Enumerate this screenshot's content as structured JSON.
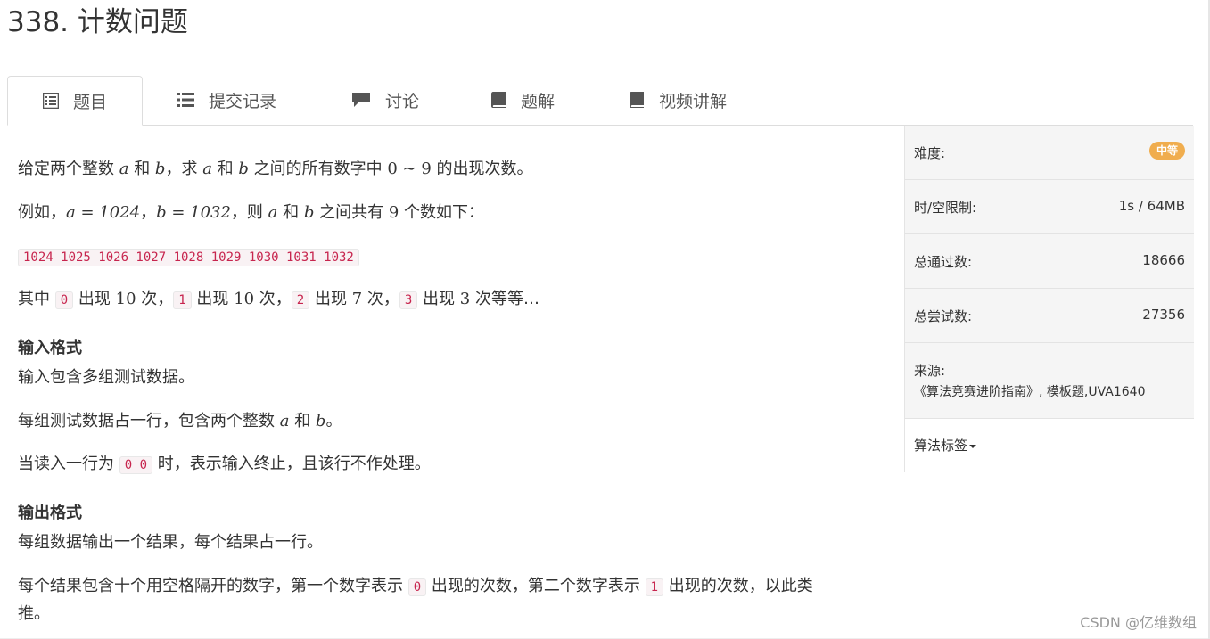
{
  "title": "338. 计数问题",
  "tabs": [
    {
      "label": "题目",
      "icon": "list-alt-icon",
      "active": true
    },
    {
      "label": "提交记录",
      "icon": "list-icon",
      "active": false
    },
    {
      "label": "讨论",
      "icon": "comment-icon",
      "active": false
    },
    {
      "label": "题解",
      "icon": "book-icon",
      "active": false
    },
    {
      "label": "视频讲解",
      "icon": "book-icon",
      "active": false
    }
  ],
  "sidebar": {
    "difficulty_label": "难度:",
    "difficulty_value": "中等",
    "difficulty_color": "#f0ad4e",
    "limit_label": "时/空限制:",
    "limit_value": "1s / 64MB",
    "passed_label": "总通过数:",
    "passed_value": "18666",
    "attempts_label": "总尝试数:",
    "attempts_value": "27356",
    "source_label": "来源:",
    "source_value": "《算法竞赛进阶指南》, 模板题,UVA1640",
    "tags_label": "算法标签"
  },
  "statement": {
    "p1": [
      "给定两个整数 ",
      "a",
      " 和 ",
      "b",
      "，求 ",
      "a",
      " 和 ",
      "b",
      " 之间的所有数字中 ",
      "0 ∼ 9",
      " 的出现次数。"
    ],
    "p2": [
      "例如，",
      "a = 1024",
      "，",
      "b = 1032",
      "，则 ",
      "a",
      " 和 ",
      "b",
      " 之间共有 ",
      "9",
      " 个数如下："
    ],
    "code_list": "1024 1025 1026 1027 1028 1029 1030 1031 1032",
    "p3": {
      "pre": "其中 ",
      "c0": "0",
      "t1": " 出现 ",
      "n1": "10",
      "t2": " 次，",
      "c1": "1",
      "t3": " 出现 ",
      "n2": "10",
      "t4": " 次，",
      "c2": "2",
      "t5": " 出现 ",
      "n3": "7",
      "t6": " 次，",
      "c3": "3",
      "t7": " 出现 ",
      "n4": "3",
      "t8": " 次等等…"
    },
    "input_heading": "输入格式",
    "input_p1": "输入包含多组测试数据。",
    "input_p2": [
      "每组测试数据占一行，包含两个整数 ",
      "a",
      " 和 ",
      "b",
      "。"
    ],
    "input_p3": {
      "pre": "当读入一行为 ",
      "code": "0 0",
      "post": " 时，表示输入终止，且该行不作处理。"
    },
    "output_heading": "输出格式",
    "output_p1": "每组数据输出一个结果，每个结果占一行。",
    "output_p2": {
      "a": "每个结果包含十个用空格隔开的数字，第一个数字表示 ",
      "c0": "0",
      "b": " 出现的次数，第二个数字表示 ",
      "c1": "1",
      "c": " 出现的次数，以此类",
      "d": "推。"
    }
  },
  "watermark": "CSDN @亿维数组"
}
